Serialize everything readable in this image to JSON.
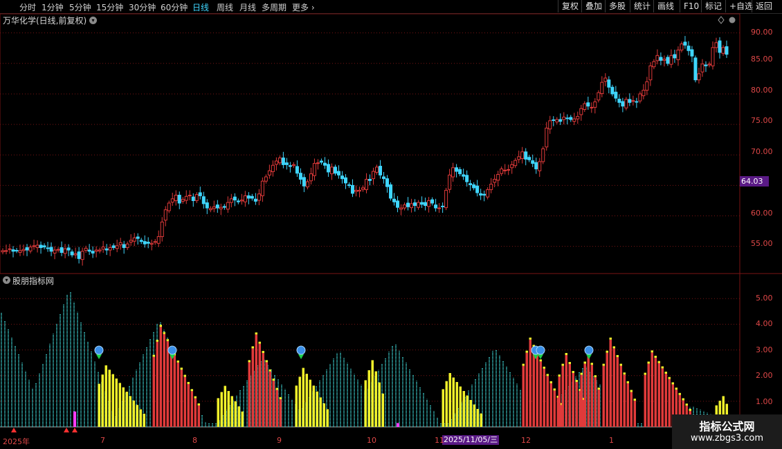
{
  "toolbar": {
    "periods": [
      "分时",
      "1分钟",
      "5分钟",
      "15分钟",
      "30分钟",
      "60分钟",
      "日线",
      "周线",
      "月线",
      "多周期",
      "更多"
    ],
    "active_period": "日线",
    "buttons": [
      "复权",
      "叠加",
      "多股",
      "统计",
      "画线",
      "F10",
      "标记",
      "+自选",
      "返回"
    ]
  },
  "main_chart": {
    "title": "万华化学(日线,前复权)",
    "current_price_tag": "64.03",
    "y_ticks": [
      "90.00",
      "85.00",
      "80.00",
      "75.00",
      "70.00",
      "60.00",
      "55.00"
    ]
  },
  "indicator": {
    "title": "股朋指标网",
    "y_ticks": [
      "5.00",
      "4.00",
      "3.00",
      "2.00",
      "1.00"
    ]
  },
  "x_axis": {
    "labels": [
      "2025年",
      "7",
      "8",
      "9",
      "10",
      "11",
      "12",
      "1"
    ],
    "cursor_date": "2025/11/05/三"
  },
  "watermark": {
    "title": "指标公式网",
    "url": "www.zbgs3.com"
  },
  "colors": {
    "up": "#e03a3a",
    "down": "#3fd6ff",
    "yellow": "#f0f02a",
    "magenta": "#ff3cff",
    "grid": "#7a1414"
  },
  "chart_data": [
    {
      "type": "candlestick",
      "title": "万华化学(日线,前复权)",
      "ylim": [
        51,
        92
      ],
      "closes": [
        54.3,
        54.3,
        54.6,
        54.2,
        54.3,
        54.3,
        54.5,
        54.4,
        54.9,
        55.1,
        55.2,
        54.8,
        54.9,
        54.7,
        54.2,
        54.4,
        54.5,
        54.0,
        54.6,
        54.4,
        53.6,
        53.8,
        53.0,
        54.2,
        54.7,
        54.2,
        53.9,
        54.4,
        54.4,
        54.9,
        54.4,
        54.8,
        54.8,
        55.1,
        55.6,
        54.8,
        55.4,
        56.0,
        56.4,
        56.3,
        55.8,
        55.4,
        55.5,
        55.5,
        55.8,
        56.6,
        59.0,
        61.0,
        62.1,
        62.8,
        63.4,
        62.1,
        62.7,
        63.2,
        63.4,
        62.5,
        63.5,
        63.3,
        62.0,
        61.3,
        61.2,
        61.5,
        61.3,
        61.4,
        61.4,
        62.2,
        62.8,
        62.6,
        62.3,
        62.6,
        63.3,
        62.9,
        62.9,
        62.4,
        63.6,
        65.7,
        66.4,
        67.4,
        68.3,
        69.0,
        69.5,
        68.4,
        68.4,
        68.1,
        68.4,
        67.0,
        66.0,
        64.9,
        65.6,
        66.9,
        68.6,
        68.7,
        68.8,
        68.3,
        67.2,
        68.0,
        67.0,
        66.7,
        66.1,
        65.4,
        65.0,
        63.7,
        64.2,
        64.2,
        64.6,
        66.0,
        65.8,
        67.3,
        68.0,
        66.7,
        66.1,
        64.8,
        62.9,
        62.3,
        61.4,
        61.3,
        61.8,
        61.5,
        62.0,
        61.7,
        62.2,
        61.9,
        61.7,
        62.5,
        62.1,
        61.3,
        61.3,
        61.5,
        64.2,
        66.7,
        67.9,
        67.3,
        66.9,
        66.5,
        65.6,
        65.1,
        64.6,
        63.8,
        63.4,
        63.4,
        64.3,
        65.2,
        66.0,
        66.8,
        67.7,
        67.5,
        67.6,
        68.4,
        69.1,
        69.7,
        70.5,
        69.3,
        69.2,
        68.6,
        67.7,
        68.9,
        71.0,
        74.4,
        75.6,
        75.7,
        75.8,
        75.5,
        76.2,
        76.0,
        75.8,
        75.9,
        76.3,
        77.6,
        78.4,
        78.0,
        77.8,
        78.7,
        80.2,
        81.9,
        82.6,
        81.1,
        80.0,
        79.3,
        78.6,
        78.0,
        79.1,
        78.6,
        78.9,
        78.7,
        80.0,
        80.6,
        82.0,
        84.6,
        85.3,
        86.3,
        85.5,
        85.7,
        85.0,
        86.3,
        85.9,
        87.2,
        88.2,
        88.0,
        87.1,
        86.2,
        82.3,
        83.3,
        84.9,
        84.6,
        84.9,
        87.6,
        88.4,
        86.8,
        87.6,
        86.5
      ],
      "gaps": "~5 session gap pattern represented by sequential closes"
    },
    {
      "type": "bar",
      "title": "股朋指标网",
      "ylim": [
        0,
        5.6
      ],
      "series": [
        {
          "name": "red",
          "values": [
            3.2,
            3.7,
            3.9,
            3.1,
            2.8,
            2.6,
            2.4,
            2.2,
            2.0,
            1.9,
            1.7,
            1.6,
            1.5,
            1.3,
            1.2,
            1.0,
            0.9,
            0.8,
            0.7,
            0.6
          ]
        },
        {
          "name": "yellow",
          "values": [
            1.0,
            2.0,
            1.6,
            2.4,
            1.9,
            1.7,
            1.5,
            1.2,
            1.0,
            0.8,
            0.7,
            0.6
          ]
        }
      ]
    }
  ]
}
